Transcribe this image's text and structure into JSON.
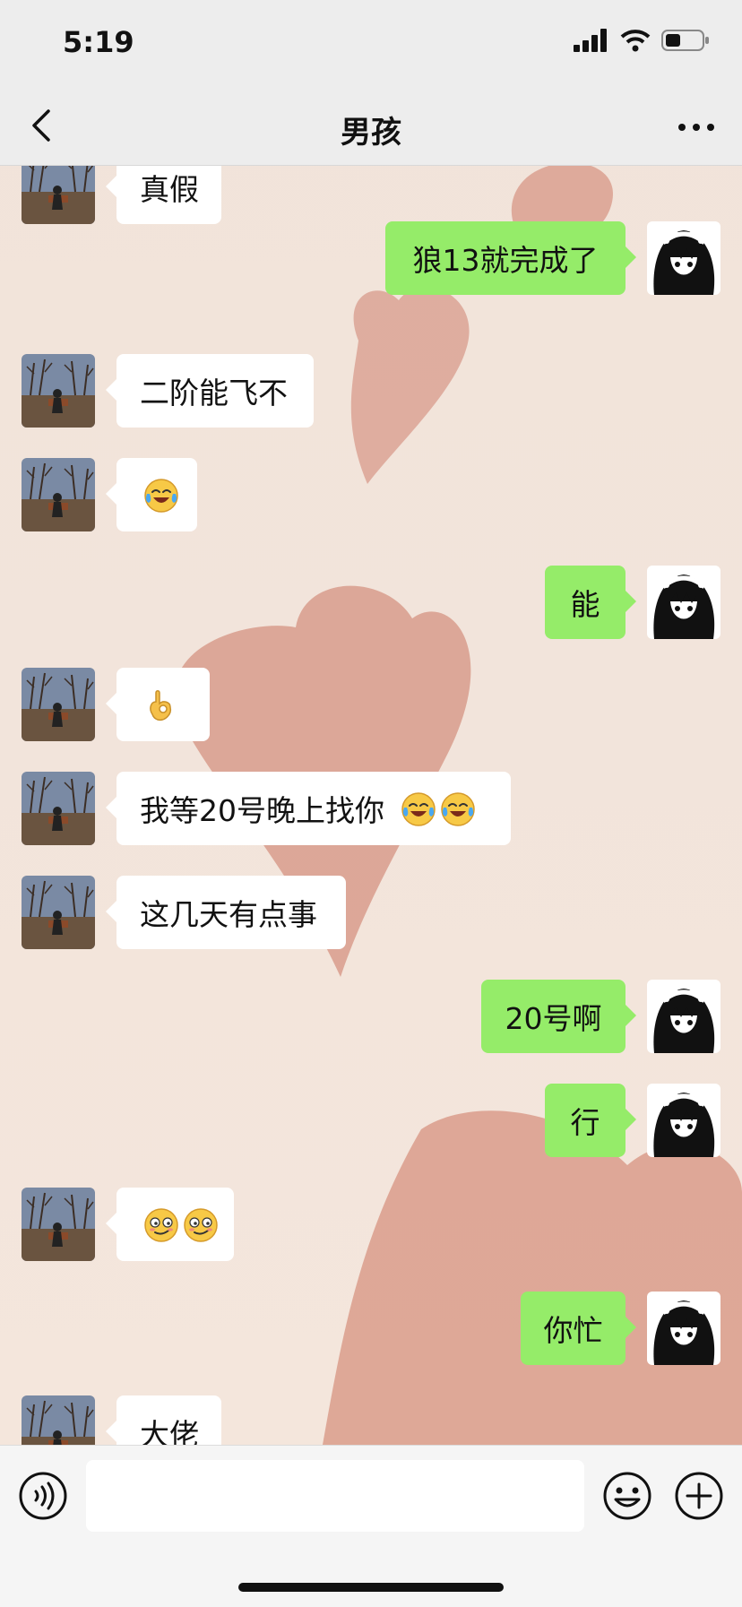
{
  "status_bar": {
    "time": "5:19"
  },
  "header": {
    "title": "男孩"
  },
  "messages": [
    {
      "side": "in",
      "text": "真假"
    },
    {
      "side": "out",
      "text": "狼13就完成了"
    },
    {
      "side": "in",
      "text": "二阶能飞不"
    },
    {
      "side": "in",
      "text": "",
      "emoji": [
        "laugh-cry"
      ]
    },
    {
      "side": "out",
      "text": "能"
    },
    {
      "side": "in",
      "text": "",
      "emoji": [
        "ok-hand"
      ]
    },
    {
      "side": "in",
      "text": "我等20号晚上找你",
      "emoji": [
        "laugh-cry",
        "laugh-cry"
      ]
    },
    {
      "side": "in",
      "text": "这几天有点事"
    },
    {
      "side": "out",
      "text": "20号啊"
    },
    {
      "side": "out",
      "text": "行"
    },
    {
      "side": "in",
      "text": "",
      "emoji": [
        "smirk",
        "smirk"
      ]
    },
    {
      "side": "out",
      "text": "你忙"
    },
    {
      "side": "in",
      "text": "大佬"
    }
  ],
  "input_bar": {
    "placeholder": ""
  },
  "colors": {
    "incoming_bubble": "#ffffff",
    "outgoing_bubble": "#95ec69",
    "bar_bg": "#ededed"
  }
}
